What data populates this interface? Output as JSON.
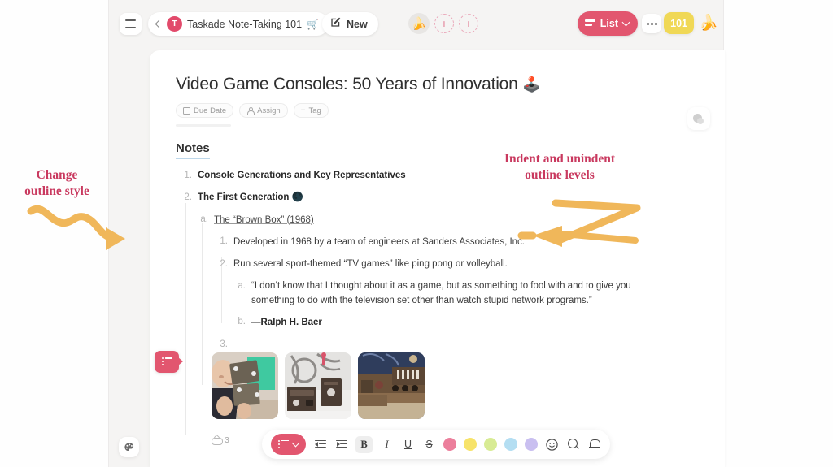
{
  "topbar": {
    "menu_icon": "hamburger-icon",
    "back_icon": "chevron-left-icon",
    "workspace_initial": "T",
    "breadcrumb_title": "Taskade Note-Taking 101",
    "breadcrumb_emoji": "🛒",
    "new_label": "New",
    "new_icon": "compose-icon",
    "avatar_emoji": "🍌",
    "add_member_icon": "plus-icon",
    "view_button_label": "List",
    "view_button_icon": "list-view-icon",
    "view_button_chevron": "chevron-down-icon",
    "more_icon": "ellipsis-icon",
    "points_badge": "101",
    "user_avatar_emoji": "🍌"
  },
  "document": {
    "title": "Video Game Consoles: 50 Years of Innovation",
    "title_emoji": "🕹️",
    "meta_chips": [
      {
        "label": "Due Date",
        "icon": "calendar-icon"
      },
      {
        "label": "Assign",
        "icon": "person-icon"
      },
      {
        "label": "Tag",
        "icon": "plus-icon"
      }
    ],
    "section_heading": "Notes",
    "outline": [
      {
        "marker": "1.",
        "level": 1,
        "style": "bold",
        "text": "Console Generations and Key Representatives"
      },
      {
        "marker": "2.",
        "level": 1,
        "style": "bold",
        "text": "The First Generation 🌑"
      },
      {
        "marker": "a.",
        "level": 2,
        "style": "underline",
        "text": "The “Brown Box” (1968)"
      },
      {
        "marker": "1.",
        "level": 3,
        "style": "normal",
        "text": "Developed in 1968 by a team of engineers at Sanders Associates, Inc."
      },
      {
        "marker": "2.",
        "level": 3,
        "style": "normal",
        "text": "Run several sport-themed “TV games” like ping pong or volleyball."
      },
      {
        "marker": "a.",
        "level": 4,
        "style": "normal",
        "text": "“I don’t know that I thought about it as a game, but as something to fool with and to give you something to do with the television set other than watch stupid network programs.”"
      },
      {
        "marker": "b.",
        "level": 4,
        "style": "bold",
        "text": "—Ralph H. Baer"
      },
      {
        "marker": "3.",
        "level": 3,
        "style": "normal",
        "text": ""
      }
    ],
    "images": [
      {
        "alt": "Ralph Baer holding the Brown Box prototype"
      },
      {
        "alt": "Brown Box console with cables and accessories"
      },
      {
        "alt": "Early console hardware with switch panel"
      }
    ],
    "attachment_count": "3",
    "attachment_icon": "upload-cloud-icon",
    "style_button_icon": "outline-style-icon",
    "side_float_icon": "comment-icon"
  },
  "format_toolbar": {
    "list_style_icon": "list-style-icon",
    "list_style_chevron": "chevron-down-icon",
    "outdent_icon": "outdent-icon",
    "indent_icon": "indent-icon",
    "bold_label": "B",
    "italic_label": "I",
    "underline_label": "U",
    "strikethrough_label": "S",
    "colors": [
      {
        "name": "pink-swatch",
        "hex": "#ec7f9c"
      },
      {
        "name": "yellow-swatch",
        "hex": "#f7e36a"
      },
      {
        "name": "green-swatch",
        "hex": "#d8eb94"
      },
      {
        "name": "blue-swatch",
        "hex": "#b4def2"
      },
      {
        "name": "purple-swatch",
        "hex": "#c9bff0"
      }
    ],
    "emoji_icon": "smiley-icon",
    "search_icon": "search-icon",
    "notification_icon": "bell-icon"
  },
  "theme_button": {
    "icon": "palette-icon"
  },
  "annotations": {
    "left": {
      "line1": "Change",
      "line2": "outline style",
      "color": "#c9395f",
      "arrow_color": "#f0b75a"
    },
    "right": {
      "line1": "Indent and unindent",
      "line2": "outline levels",
      "color": "#c9395f",
      "arrow_color": "#f0b75a"
    }
  },
  "colors": {
    "accent_pink": "#e2566f",
    "badge_yellow": "#f0d856",
    "page_bg": "#f5f4f3",
    "card_bg": "#ffffff"
  }
}
